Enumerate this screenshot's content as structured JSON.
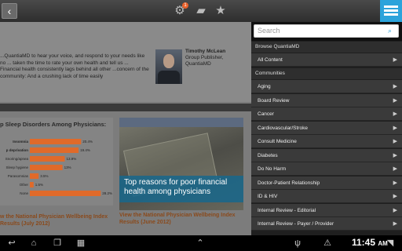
{
  "topbar": {
    "back_icon": "‹",
    "notification_icon": "gear-badge-icon",
    "notification_count": "1",
    "chat_icon": "speech-bubble-icon",
    "star_icon": "star-icon",
    "menu_icon": "menu-icon",
    "accent": "#2ba3db"
  },
  "hero": {
    "text": "...QuantiaMD to hear your voice, and respond to your needs like no ... taken the time to rate your own health and tell us ... Financial health consistently lags behind all other ...concern of the community: And a crushing lack of time easily",
    "author_name": "Timothy McLean",
    "author_role": "Group Publisher,",
    "author_org": "QuantiaMD"
  },
  "card1": {
    "title": "p Sleep Disorders Among Physicians:",
    "link": "w the National Physician Wellbeing Index Results (July 2012)"
  },
  "chart_data": {
    "type": "bar",
    "categories": [
      "Insomnia",
      "p deprivation",
      "Snoring/apnea",
      "Sleep hygiene",
      "Parasomnias",
      "Other",
      "None"
    ],
    "values": [
      20.4,
      19.4,
      13.9,
      13,
      3.5,
      1.5,
      28.2
    ],
    "value_labels": [
      "20.4%",
      "19.4%",
      "13.9%",
      "13%",
      "3.5%",
      "1.5%",
      "28.2%"
    ],
    "xlim": [
      0,
      30
    ],
    "bar_color": "#e06a2a",
    "grid": false
  },
  "card2": {
    "headline": "Top reasons for poor financial health among physicians",
    "link": "View the National Physician Wellbeing Index Results (June 2012)"
  },
  "panel": {
    "search_placeholder": "Search",
    "browse_header": "Browse QuantiaMD",
    "all_content": "All Content",
    "communities_header": "Communities",
    "items": [
      "Aging",
      "Board Review",
      "Cancer",
      "Cardiovascular/Stroke",
      "Consult Medicine",
      "Diabetes",
      "Do No Harm",
      "Doctor-Patient Relationship",
      "ID & HIV",
      "Internal Review - Editorial",
      "Internal Review - Payer / Provider"
    ],
    "arrow": "▶"
  },
  "navbar": {
    "time": "11:45",
    "ampm": "AM"
  }
}
